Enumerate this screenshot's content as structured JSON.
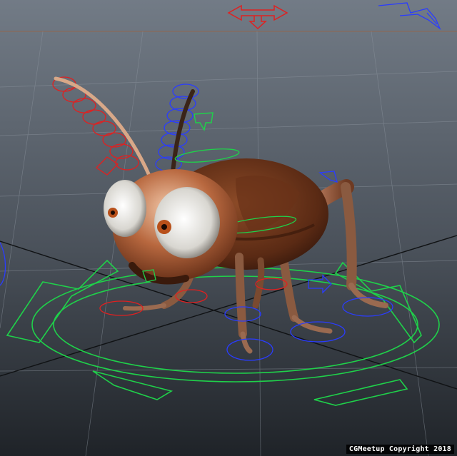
{
  "viewport": {
    "name": "3D perspective viewport",
    "watermark": "CGMeetup Copyright 2018"
  },
  "colors": {
    "background_top": "#6f7884",
    "background_bottom": "#1f2328",
    "grid": "#8a929c",
    "axis": "#111111",
    "control_green": "#1fd14a",
    "control_red": "#e02020",
    "control_blue": "#2a3cff",
    "body_brown": "#7a3a1c",
    "eye_white": "#f4f4f0",
    "pupil": "#b8501a"
  },
  "scene": {
    "character": "cartoon cricket rig",
    "icons": [
      "move-arrow-icon",
      "rotate-circle-icon",
      "view-cube-axis-icon"
    ]
  }
}
